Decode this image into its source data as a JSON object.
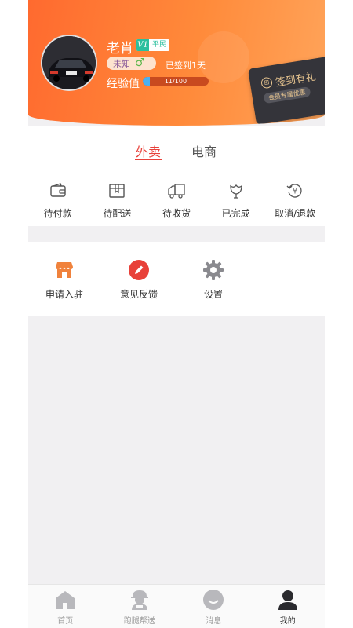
{
  "profile": {
    "username": "老肖",
    "vip_level": "V1",
    "vip_label": "平民",
    "gender_text": "未知",
    "gender_symbol": "♂",
    "signed_days": "已签到1天",
    "exp_label": "经验值",
    "exp_text": "11/100",
    "exp_progress": 0.11
  },
  "signin_card": {
    "icon": "gift-icon",
    "title": "签到有礼",
    "subtitle": "会员专属优惠"
  },
  "tabs": [
    {
      "label": "外卖",
      "active": true
    },
    {
      "label": "电商",
      "active": false
    }
  ],
  "orders": [
    {
      "label": "待付款",
      "icon": "wallet-icon"
    },
    {
      "label": "待配送",
      "icon": "package-icon"
    },
    {
      "label": "待收货",
      "icon": "delivery-truck-icon"
    },
    {
      "label": "已完成",
      "icon": "flower-icon"
    },
    {
      "label": "取消/退款",
      "icon": "refund-icon"
    }
  ],
  "tools": [
    {
      "label": "申请入驻",
      "icon": "shop-icon"
    },
    {
      "label": "意见反馈",
      "icon": "pencil-icon"
    },
    {
      "label": "设置",
      "icon": "gear-icon"
    }
  ],
  "tabbar": [
    {
      "label": "首页",
      "icon": "home-icon",
      "active": false
    },
    {
      "label": "跑腿帮送",
      "icon": "courier-icon",
      "active": false
    },
    {
      "label": "消息",
      "icon": "message-icon",
      "active": false
    },
    {
      "label": "我的",
      "icon": "user-icon",
      "active": true
    }
  ],
  "colors": {
    "header_start": "#ff6a2f",
    "header_end": "#ffa45a",
    "accent_red": "#e8413a",
    "vip_green": "#2bbf9e",
    "gold": "#e9c690"
  }
}
